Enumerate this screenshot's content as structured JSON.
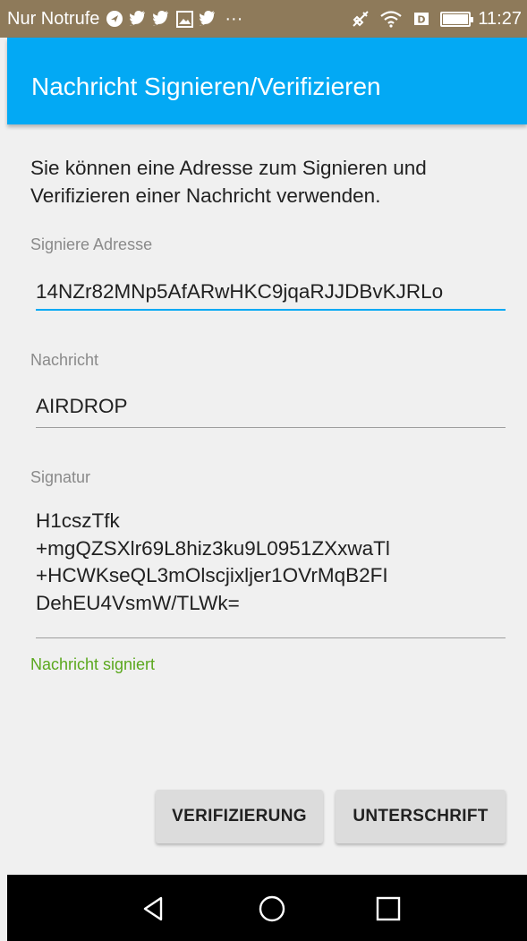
{
  "status_bar": {
    "carrier": "Nur Notrufe",
    "overflow": "···",
    "time": "11:27",
    "left_icons": [
      "navigation-icon",
      "twitter-icon",
      "twitter-icon",
      "gallery-icon",
      "twitter-icon"
    ],
    "right_icons": [
      "mute-icon",
      "wifi-icon",
      "sim-icon",
      "battery-icon"
    ]
  },
  "app_bar": {
    "title": "Nachricht Signieren/Verifizieren"
  },
  "description": "Sie können eine Adresse zum Signieren und Verifizieren einer Nachricht verwenden.",
  "fields": {
    "address": {
      "label": "Signiere Adresse",
      "value": "14NZr82MNp5AfARwHKC9jqaRJJDBvKJRLo"
    },
    "message": {
      "label": "Nachricht",
      "value": "AIRDROP"
    },
    "signature": {
      "label": "Signatur",
      "value": "H1cszTfk\n+mgQZSXlr69L8hiz3ku9L0951ZXxwaTl\n+HCWKseQL3mOlscjixljer1OVrMqB2FI\nDehEU4VsmW/TLWk="
    }
  },
  "status_message": "Nachricht signiert",
  "buttons": {
    "verify": "VERIFIZIERUNG",
    "sign": "UNTERSCHRIFT"
  },
  "nav": {
    "back": "back-icon",
    "home": "home-icon",
    "recents": "recents-icon"
  },
  "colors": {
    "accent": "#03a9f4",
    "status_bar": "#8e7a5a",
    "success": "#5ba81e",
    "button_bg": "#dcdcdc"
  }
}
